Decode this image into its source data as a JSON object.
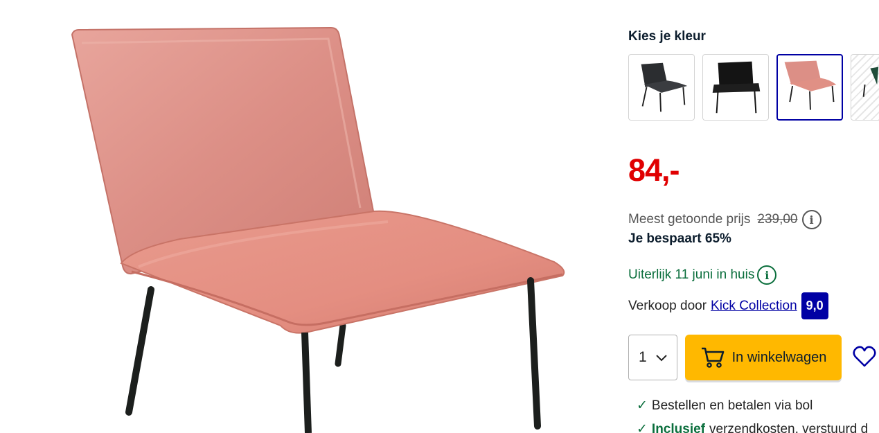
{
  "product": {
    "image_alt": "Velvet lounge chair in old pink with black metal legs"
  },
  "color_picker": {
    "title": "Kies je kleur",
    "swatches": [
      {
        "name": "dark grey",
        "color": "#2b2d30",
        "selected": false
      },
      {
        "name": "black",
        "color": "#141414",
        "selected": false
      },
      {
        "name": "pink",
        "color": "#d98780",
        "selected": true
      },
      {
        "name": "green",
        "color": "#1f4d3a",
        "selected": false
      }
    ]
  },
  "pricing": {
    "price": "84,-",
    "previous_label": "Meest getoonde prijs",
    "previous_price": "239,00",
    "savings": "Je bespaart 65%"
  },
  "delivery": {
    "text": "Uiterlijk 11 juni in huis"
  },
  "seller": {
    "label": "Verkoop door",
    "name": "Kick Collection",
    "rating": "9,0"
  },
  "purchase": {
    "quantity": "1",
    "cart_label": "In winkelwagen"
  },
  "usps": [
    {
      "bold": "",
      "text": "Bestellen en betalen via bol"
    },
    {
      "bold": "Inclusief",
      "text": "verzendkosten, verstuurd d"
    }
  ],
  "colors": {
    "price_red": "#e00001",
    "brand_blue": "#0000a4",
    "button_yellow": "#ffb800",
    "success_green": "#0a6e3c"
  }
}
